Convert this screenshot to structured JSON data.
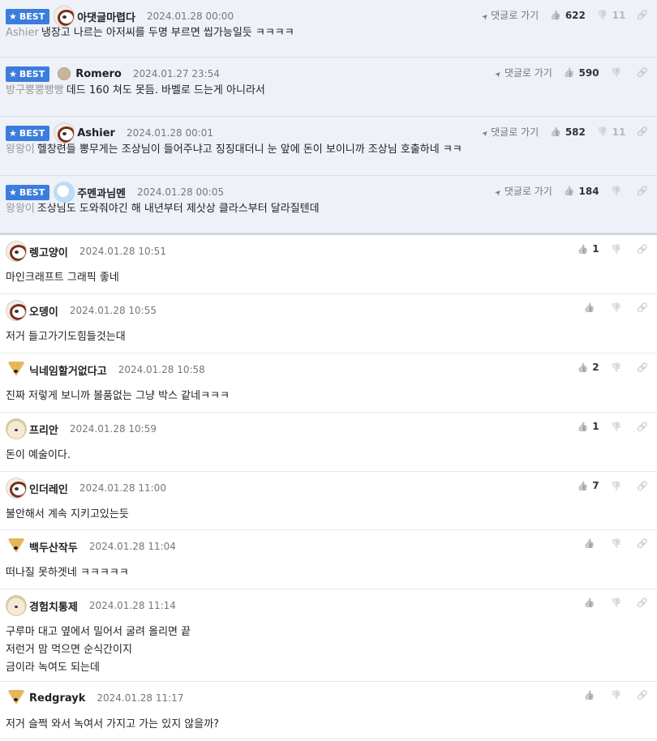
{
  "labels": {
    "best": "BEST",
    "reply": "댓글로 가기"
  },
  "comments": [
    {
      "nick": "아댓글마렵다",
      "date": "2024.01.28 00:00",
      "avatar": "bear-icon",
      "best": true,
      "mention": "Ashier",
      "lines": [
        "냉장고 나르는 아저씨를 두명 부르면 씹가능일듯 ㅋㅋㅋㅋ"
      ],
      "up": "622",
      "down": "11"
    },
    {
      "nick": "Romero",
      "date": "2024.01.27 23:54",
      "avatar": "dot-icon",
      "best": true,
      "mention": "방구뿡뿡빵빵",
      "lines": [
        "데드 160 쳐도 못듬. 바벨로 드는게 아니라서"
      ],
      "up": "590",
      "down": ""
    },
    {
      "nick": "Ashier",
      "date": "2024.01.28 00:01",
      "avatar": "bear-icon",
      "best": true,
      "mention": "왕왕이",
      "lines": [
        "헬창련들 뽕무게는 조상님이 들어주냐고 징징대더니 눈 앞에 돈이 보이니까 조상님 호출하네 ㅋㅋ"
      ],
      "up": "582",
      "down": "11"
    },
    {
      "nick": "주멘과님멘",
      "date": "2024.01.28 00:05",
      "avatar": "blue-icon",
      "best": true,
      "mention": "왕왕이",
      "lines": [
        "조상님도 도와줘야긴 해 내년부터 제삿상 클라스부터 달라질텐데"
      ],
      "up": "184",
      "down": ""
    },
    {
      "nick": "렝고양이",
      "date": "2024.01.28 10:51",
      "avatar": "bear-icon",
      "best": false,
      "mention": "",
      "lines": [
        "마인크래프트 그래픽 좋네"
      ],
      "up": "1",
      "down": ""
    },
    {
      "nick": "오뎅이",
      "date": "2024.01.28 10:55",
      "avatar": "bear-icon",
      "best": false,
      "mention": "",
      "lines": [
        "저거 들고가기도힘들것는대"
      ],
      "up": "",
      "down": ""
    },
    {
      "nick": "닉네임할거없다고",
      "date": "2024.01.28 10:58",
      "avatar": "fox-icon",
      "best": false,
      "mention": "",
      "lines": [
        "진짜 저렇게 보니까 볼품없는 그냥 박스 같네ㅋㅋㅋ"
      ],
      "up": "2",
      "down": ""
    },
    {
      "nick": "프리안",
      "date": "2024.01.28 10:59",
      "avatar": "puppy-icon",
      "best": false,
      "mention": "",
      "lines": [
        "돈이 예술이다."
      ],
      "up": "1",
      "down": ""
    },
    {
      "nick": "인더레인",
      "date": "2024.01.28 11:00",
      "avatar": "bear-icon",
      "best": false,
      "mention": "",
      "lines": [
        "불안해서 계속 지키고있는듯"
      ],
      "up": "7",
      "down": ""
    },
    {
      "nick": "백두산작두",
      "date": "2024.01.28 11:04",
      "avatar": "fox-icon",
      "best": false,
      "mention": "",
      "lines": [
        "떠나질 못하겟네 ㅋㅋㅋㅋㅋ"
      ],
      "up": "",
      "down": ""
    },
    {
      "nick": "경험치통제",
      "date": "2024.01.28 11:14",
      "avatar": "puppy-icon",
      "best": false,
      "mention": "",
      "lines": [
        "구루마 대고 옆에서 밀어서 굴려 올리면 끝",
        "저런거 맘 먹으면 순식간이지",
        "금이라 녹여도 되는데"
      ],
      "up": "",
      "down": ""
    },
    {
      "nick": "Redgrayk",
      "date": "2024.01.28 11:17",
      "avatar": "fox-icon",
      "best": false,
      "mention": "",
      "lines": [
        "저거 슬쩍 와서 녹여서 가지고 가는 있지 않을까?"
      ],
      "up": "",
      "down": ""
    }
  ]
}
